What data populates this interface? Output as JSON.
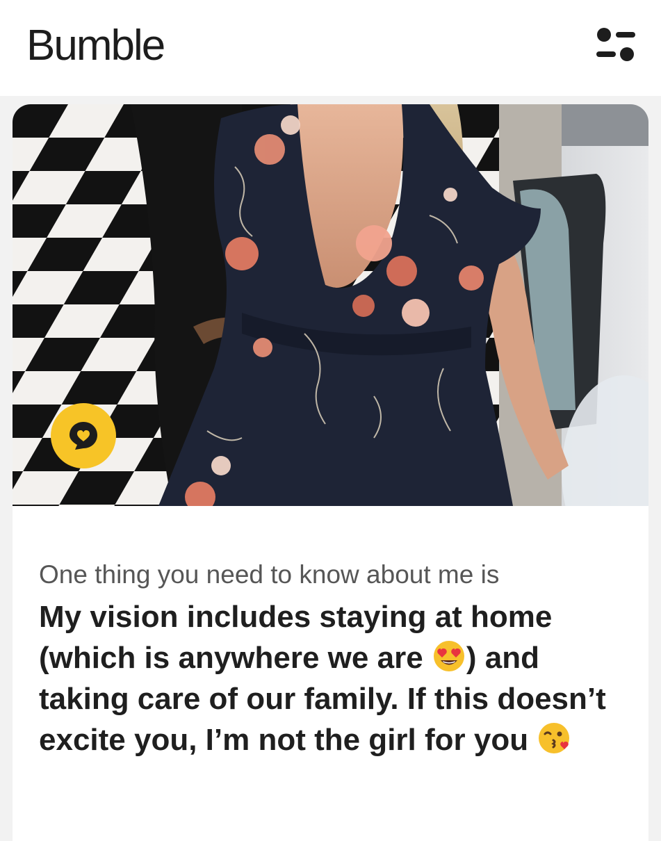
{
  "header": {
    "brand": "Bumble",
    "filter_icon": "filter-sliders-icon"
  },
  "profile": {
    "photo_description_icon": "profile-photo",
    "compliment_icon": "compliment-heart-icon"
  },
  "prompt": {
    "question": "One thing you need to know about me is",
    "answer_part1": "My vision includes staying at home (which is anywhere we are ",
    "emoji1": "heart-eyes-emoji-icon",
    "answer_part2": ") and taking care of our family. If this doesn’t excite you, I’m not the girl for you ",
    "emoji2": "kissing-face-emoji-icon"
  },
  "colors": {
    "accent": "#f7c427",
    "text_dark": "#1f1f1f",
    "text_gray": "#565656"
  }
}
